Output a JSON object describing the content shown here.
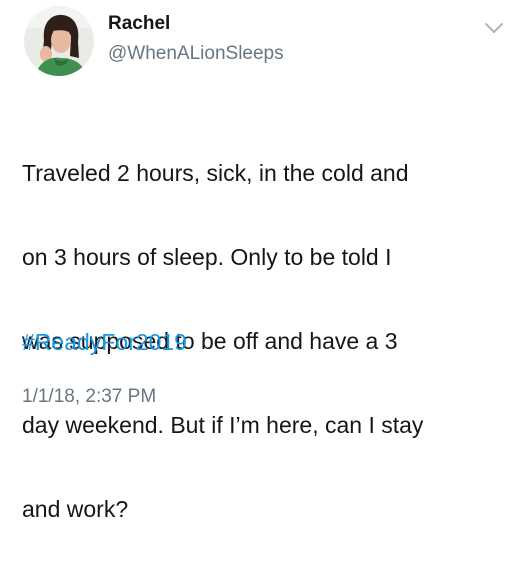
{
  "tweet": {
    "author": {
      "name": "Rachel",
      "handle": "@WhenALionSleeps",
      "avatar": "profile-photo"
    },
    "text_lines": [
      "Traveled 2 hours, sick, in the cold and",
      "on 3 hours of sleep. Only to be told I",
      "was supposed to be off and have a 3",
      "day weekend. But if I’m here, can I stay",
      "and work?"
    ],
    "hashtag": "#ReadyFor2019",
    "timestamp": "1/1/18, 2:37 PM",
    "menu_icon": "chevron-down-icon"
  },
  "colors": {
    "text": "#14171a",
    "secondary": "#657786",
    "link": "#1b95e0",
    "background": "#ffffff"
  }
}
